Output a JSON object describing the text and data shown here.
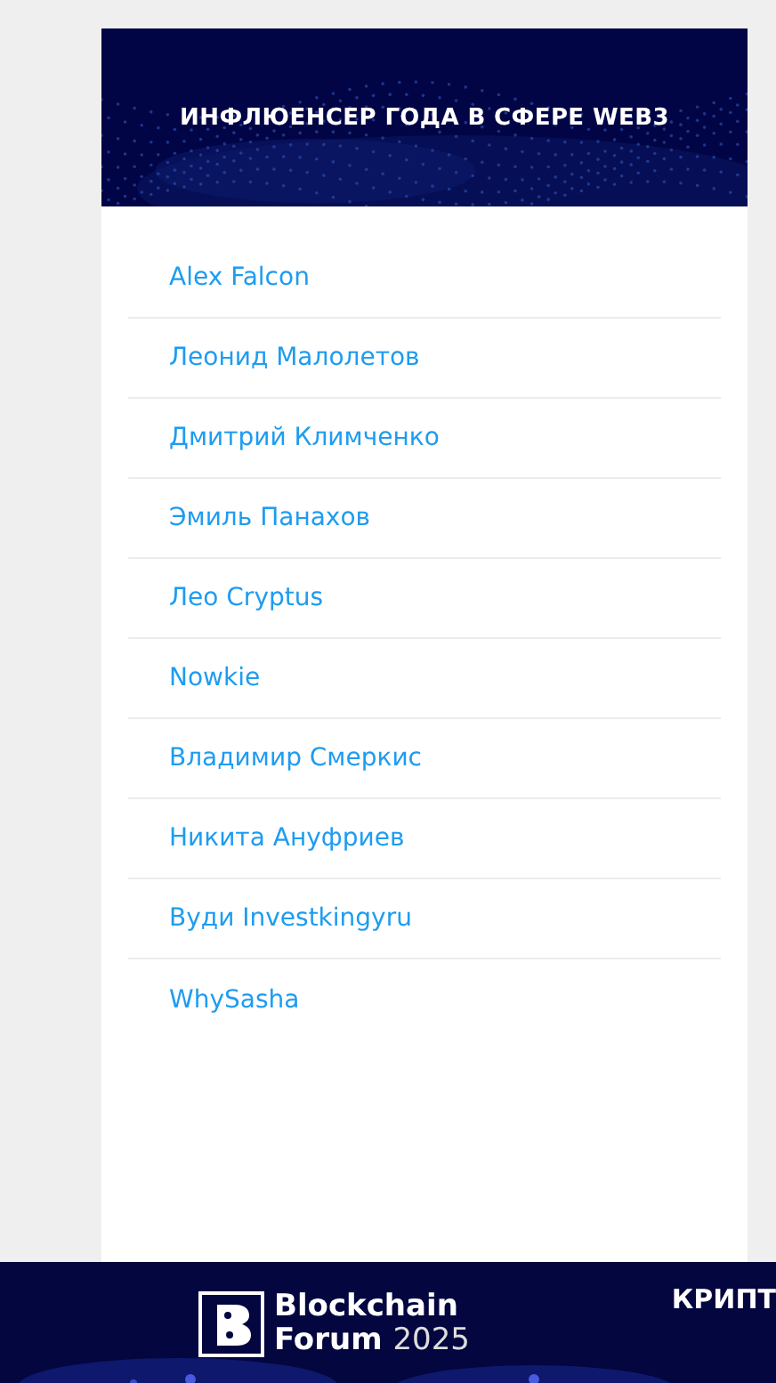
{
  "card": {
    "title": "ИНФЛЮЕНСЕР ГОДА В СФЕРЕ WEB3",
    "items": [
      {
        "label": "Alex Falcon"
      },
      {
        "label": "Леонид Малолетов"
      },
      {
        "label": "Дмитрий Климченко"
      },
      {
        "label": "Эмиль Панахов"
      },
      {
        "label": "Лео Cryptus"
      },
      {
        "label": "Nowkie"
      },
      {
        "label": "Владимир Смеркис"
      },
      {
        "label": "Никита Ануфриев"
      },
      {
        "label": "Вуди Investkingyru"
      },
      {
        "label": "WhySasha"
      }
    ]
  },
  "footer": {
    "logo_line_1": "Blockchain",
    "logo_line_2": "Forum",
    "logo_year": "2025",
    "heading": "КРИПТ"
  }
}
